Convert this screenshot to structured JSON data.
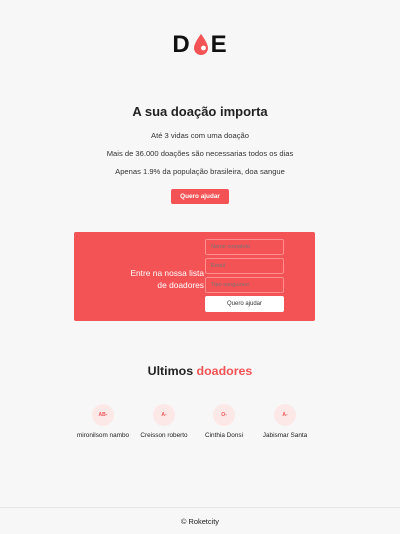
{
  "logo": {
    "letters": [
      "D",
      "E"
    ]
  },
  "intro": {
    "title": "A sua doação importa",
    "line1": "Até 3 vidas com uma doação",
    "line2": "Mais de 36.000 doações são necessarias todos os dias",
    "line3": "Apenas 1.9% da população brasileira, doa sangue",
    "button": "Quero ajudar"
  },
  "signup": {
    "text_line1": "Entre na nossa lista",
    "text_line2": "de doadores",
    "name_placeholder": "Nome completo",
    "email_placeholder": "Email",
    "blood_placeholder": "Tipo sanguineo",
    "submit": "Quero ajudar"
  },
  "donors": {
    "title": "Ultimos",
    "title_accent": "doadores",
    "items": [
      {
        "blood": "AB-",
        "name": "mironilsom nambo"
      },
      {
        "blood": "A-",
        "name": "Creisson roberto"
      },
      {
        "blood": "O-",
        "name": "Cinthia Donsi"
      },
      {
        "blood": "A-",
        "name": "Jabismar Santa"
      }
    ]
  },
  "footer": {
    "text": "© Roketcity"
  },
  "colors": {
    "accent": "#f35355",
    "background": "#f7f7f7",
    "badge": "#fde8e8"
  }
}
